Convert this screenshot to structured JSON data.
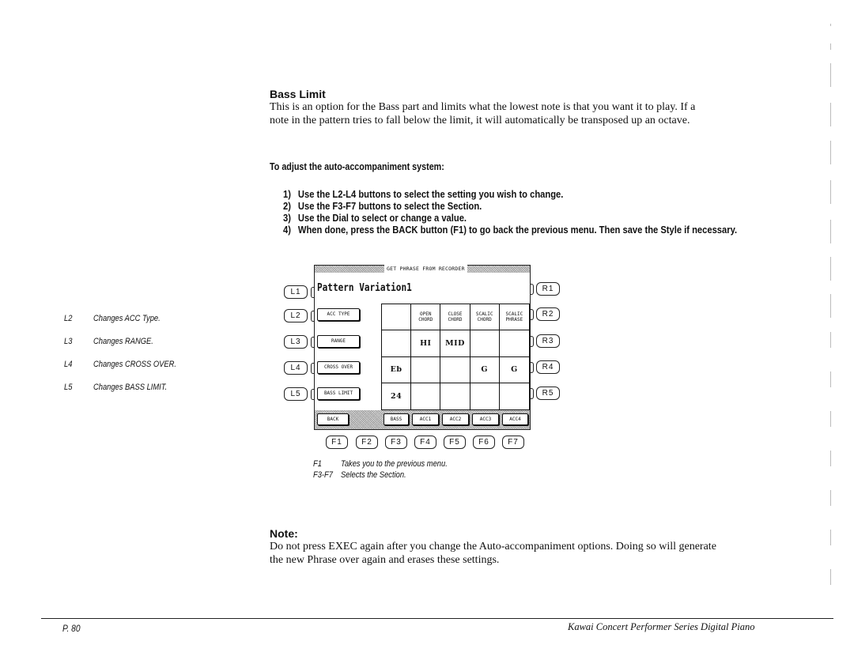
{
  "section": {
    "title": "Bass Limit",
    "paragraph": [
      "This is an option for the Bass part and limits what the lowest note is that you want it to play.  If a",
      "note in the pattern tries to fall below the limit, it will automatically be transposed up an octave."
    ]
  },
  "procedure": {
    "heading": "To adjust the auto-accompaniment system:",
    "steps": [
      {
        "num": "1)",
        "text": "Use the L2-L4 buttons to select the setting you wish to change."
      },
      {
        "num": "2)",
        "text": "Use the F3-F7 buttons to select the Section."
      },
      {
        "num": "3)",
        "text": "Use the Dial to select or change a value."
      },
      {
        "num": "4)",
        "text": "When done, press the BACK button (F1) to go back the previous menu.  Then save the Style if necessary."
      }
    ]
  },
  "side_legend": [
    {
      "key": "L2",
      "desc": "Changes ACC Type."
    },
    {
      "key": "L3",
      "desc": "Changes RANGE."
    },
    {
      "key": "L4",
      "desc": "Changes CROSS OVER."
    },
    {
      "key": "L5",
      "desc": "Changes BASS LIMIT."
    }
  ],
  "panel": {
    "left_buttons": [
      "L1",
      "L2",
      "L3",
      "L4",
      "L5"
    ],
    "right_buttons": [
      "R1",
      "R2",
      "R3",
      "R4",
      "R5"
    ],
    "f_buttons": [
      "F1",
      "F2",
      "F3",
      "F4",
      "F5",
      "F6",
      "F7"
    ],
    "lcd": {
      "header": "GET PHRASE FROM RECORDER",
      "title": "Pattern Variation1",
      "side_buttons": [
        "ACC TYPE",
        "RANGE",
        "CROSS OVER",
        "BASS LIMIT"
      ],
      "grid": [
        [
          {
            "text": "",
            "shaded": true
          },
          {
            "text": "OPEN\nCHORD",
            "shaded": false,
            "hdr": true
          },
          {
            "text": "CLOSE\nCHORD",
            "shaded": false,
            "hdr": true
          },
          {
            "text": "SCALIC\nCHORD",
            "shaded": false,
            "hdr": true
          },
          {
            "text": "SCALIC\nPHRASE",
            "shaded": false,
            "hdr": true
          }
        ],
        [
          {
            "text": "",
            "shaded": true
          },
          {
            "text": "HI",
            "shaded": false
          },
          {
            "text": "MID",
            "shaded": false
          },
          {
            "text": "",
            "shaded": true
          },
          {
            "text": "",
            "shaded": true
          }
        ],
        [
          {
            "text": "Eb",
            "shaded": false
          },
          {
            "text": "",
            "shaded": true
          },
          {
            "text": "",
            "shaded": true
          },
          {
            "text": "G",
            "shaded": false
          },
          {
            "text": "G",
            "shaded": false
          }
        ],
        [
          {
            "text": "24",
            "shaded": false
          },
          {
            "text": "",
            "shaded": true
          },
          {
            "text": "",
            "shaded": true
          },
          {
            "text": "",
            "shaded": true
          },
          {
            "text": "",
            "shaded": true
          }
        ]
      ],
      "footer_buttons": [
        "BACK",
        "BASS",
        "ACC1",
        "ACC2",
        "ACC3",
        "ACC4"
      ]
    }
  },
  "f_legend": [
    {
      "key": "F1",
      "desc": "Takes you  to the previous menu."
    },
    {
      "key": "F3-F7",
      "desc": "Selects the Section."
    }
  ],
  "note": {
    "title": "Note:",
    "paragraph": [
      "Do not press EXEC again after you change the Auto-accompaniment options.  Doing so will generate",
      "the new Phrase over again and erases these settings."
    ]
  },
  "footer": {
    "page_number": "P. 80",
    "manual_title": "Kawai Concert Performer Series Digital Piano"
  }
}
